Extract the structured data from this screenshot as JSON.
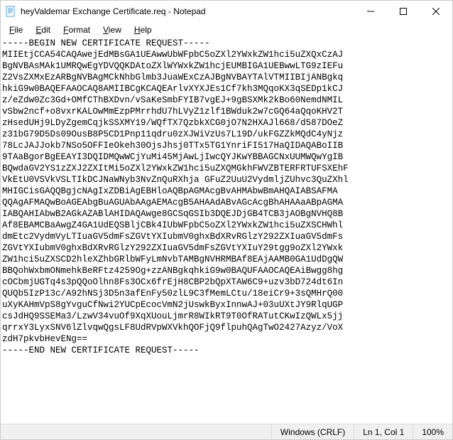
{
  "window": {
    "title": "heyValdemar Exchange Certificate.req - Notepad"
  },
  "menu": {
    "file": "File",
    "edit": "Edit",
    "format": "Format",
    "view": "View",
    "help": "Help"
  },
  "content": "-----BEGIN NEW CERTIFICATE REQUEST-----\nMIIEtjCCA54CAQAwejEdMBsGA1UEAwwUbWFpbC5oZXl2YWxkZW1hci5uZXQxCzAJ\nBgNVBAsMAk1UMRQwEgYDVQQKDAtoZXlWYWxkZW1hcjEUMBIGA1UEBwwLTG9zIEFu\nZ2VsZXMxEzARBgNVBAgMCkNhbGlmb3JuaWExCzAJBgNVBAYTAlVTMIIBIjANBgkq\nhkiG9w0BAQEFAAOCAQ8AMIIBCgKCAQEArlvXYXJEs1Cf7kh3MQqoKX3qSEDp1kCJ\nz/eZdw0Zc3Gd+OMfCThBXDvn/vSaKeSmbFYIB7vgEJ+9gBSXMk2kBo60NemdNMIL\nvSbw2ncf+o8vxrKALOwMmEzpPMrrhdU7hLVyZ1zlf1BWduk2w7cGQ64aQqoKHV2T\nzHsedUHj9LDyZgemCqjkSSXMY19/WQfTX7QzbkXCG0jO7N2HXAJl668/d587DOeZ\nz31bG79D5Ds09OusB8P5CD1Pnp11qdru0zXJWiVzUs7L19D/ukFGZZkMQdC4yNjz\n78LcJAJJokb7NSo5OFFIeOkeh30OjsJhsj0TTx5TG1YnriFI517HaQIDAQABoIIB\n9TAaBgorBgEEAYI3DQIDMQwWCjYuMi45MjAwLjIwcQYJKwYBBAGCNxUUMWQwYgIB\nBQwdaGV2YS1zZXJ2ZXItMi5oZXl2YWxkZW1hci5uZXQMGkhFWVZBTERFRTUFSXEhF\nVkEtU0VSVkVSLTIkDCJNaWNyb3NvZnQuRXhja GFuZ2UuU2VydmljZUhvc3QuZXhl\nMHIGCisGAQQBgjcNAgIxZDBiAgEBHloAQBpAGMAcgBvAHMAbwBmAHQAIABSAFMA\nQQAgAFMAQwBoAGEAbgBuAGUAbAAgAEMAcgB5AHAAdABvAGcAcgBhAHAAaABpAGMA\nIABQAHIAbwB2AGkAZABlAHIDAQAwge8GCSqGSIb3DQEJDjGB4TCB3jAOBgNVHQ8B\nAf8EBAMCBaAwgZ4GA1UdEQSBljCBk4IUbWFpbC5oZXl2YWxkZW1hci5uZXSCHWhl\ndmEtc2VydmVyLTIuaGV5dmFsZGVtYXIubmV0ghxBdXRvRGlzY292ZXIuaGV5dmFs\nZGVtYXIubmV0ghxBdXRvRGlzY292ZXIuaGV5dmFsZGVtYXIuY29tgg9oZXl2YWxk\nZW1hci5uZXSCD2hleXZhbGRlbWFyLmNvbTAMBgNVHRMBAf8EAjAAMB0GA1UdDgQW\nBBQohWxbmONmehkBeRFtz4259Og+zzANBgkqhkiG9w0BAQUFAAOCAQEAiBwgg8hg\ncOCbmjUGTq4s3pQQoOlhn8Fs3OCx6frEjH8CBP2bQpXTAW6C9+uzv3bD724dt6In\nQUQb5IzP13c/A92hNSj3D5n3afEnFy50zlL9C3fMemLCtu/18eiCr9+3sQMHrQ00\nuXyKAHmVpS8gYvguCfNwi2YUCpEcocVmN2jUswkByxInnwAJ+03uUXtJY9RlqUGP\ncsJdHQ9SSEMa3/LzwV34vuOf9XqXUouLjmrR8WIkRT9T0OfRATutCKwIzQWLx5jj\nqrrxY3LyxSNV6lZlvqwQgsLF8UdRVpWXVkhQOFjQ9flpuhQAgTwO2427Azyz/VoX\nzdH7pkvbHevENg==\n-----END NEW CERTIFICATE REQUEST-----\n",
  "status": {
    "lineEnding": "Windows (CRLF)",
    "position": "Ln 1, Col 1",
    "zoom": "100%"
  }
}
